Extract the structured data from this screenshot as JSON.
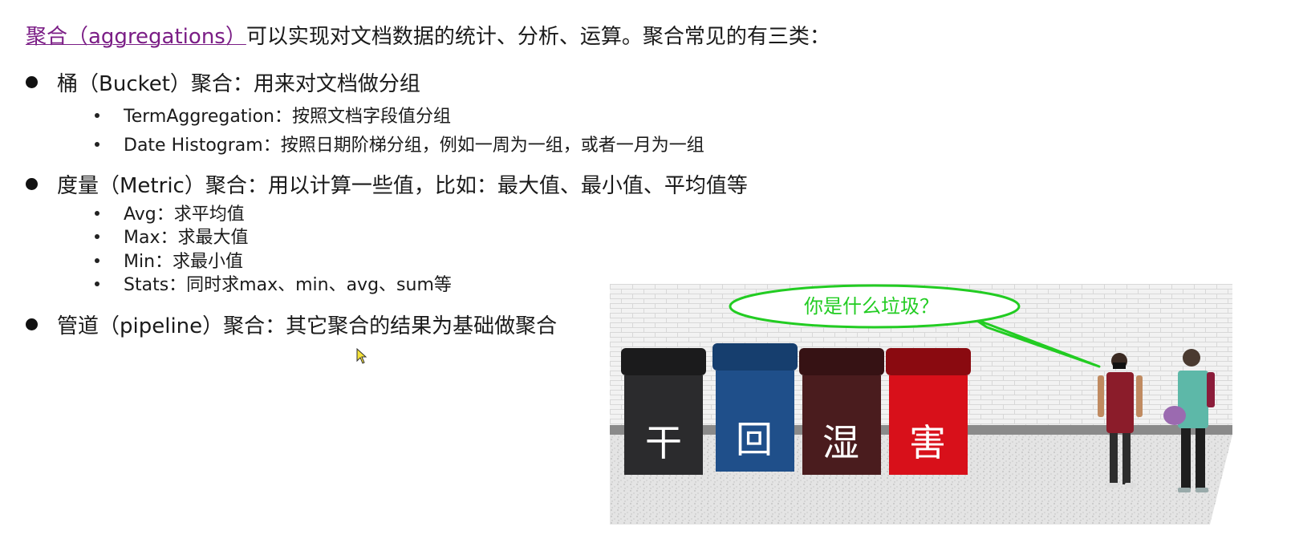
{
  "intro": {
    "link_text": "聚合（aggregations）",
    "rest": "可以实现对文档数据的统计、分析、运算。聚合常见的有三类："
  },
  "groups": [
    {
      "label": "桶（Bucket）聚合：用来对文档做分组",
      "items": [
        "TermAggregation：按照文档字段值分组",
        "Date Histogram：按照日期阶梯分组，例如一周为一组，或者一月为一组"
      ]
    },
    {
      "label": "度量（Metric）聚合：用以计算一些值，比如：最大值、最小值、平均值等",
      "items": [
        "Avg：求平均值",
        "Max：求最大值",
        "Min：求最小值",
        "Stats：同时求max、min、avg、sum等"
      ]
    },
    {
      "label": "管道（pipeline）聚合：其它聚合的结果为基础做聚合",
      "items": []
    }
  ],
  "illustration": {
    "speech": "你是什么垃圾？",
    "bins": [
      {
        "label": "干",
        "color": "#2b2b2d"
      },
      {
        "label": "回",
        "color": "#1f4f8a"
      },
      {
        "label": "湿",
        "color": "#4a1c1e"
      },
      {
        "label": "害",
        "color": "#d8101a"
      }
    ],
    "bubble_color": "#22cc22"
  }
}
